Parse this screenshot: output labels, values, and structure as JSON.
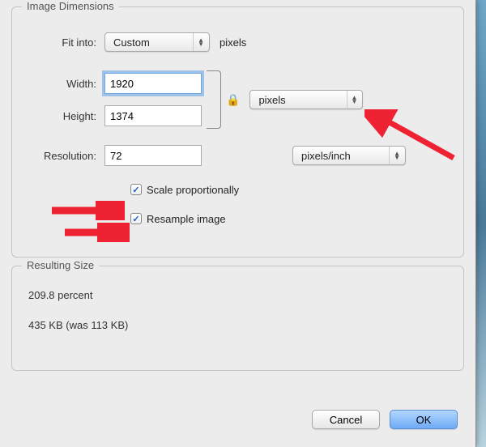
{
  "group": {
    "title": "Image Dimensions",
    "fitLabel": "Fit into:",
    "fitValue": "Custom",
    "fitUnit": "pixels",
    "widthLabel": "Width:",
    "widthValue": "1920",
    "heightLabel": "Height:",
    "heightValue": "1374",
    "dimUnit": "pixels",
    "resolutionLabel": "Resolution:",
    "resolutionValue": "72",
    "resolutionUnit": "pixels/inch",
    "scaleLabel": "Scale proportionally",
    "scaleChecked": true,
    "resampleLabel": "Resample image",
    "resampleChecked": true,
    "lockIcon": "🔒"
  },
  "result": {
    "title": "Resulting Size",
    "percentLine": "209.8 percent",
    "sizeLine": "435 KB (was 113 KB)"
  },
  "buttons": {
    "cancel": "Cancel",
    "ok": "OK"
  },
  "checkmark": "✓"
}
